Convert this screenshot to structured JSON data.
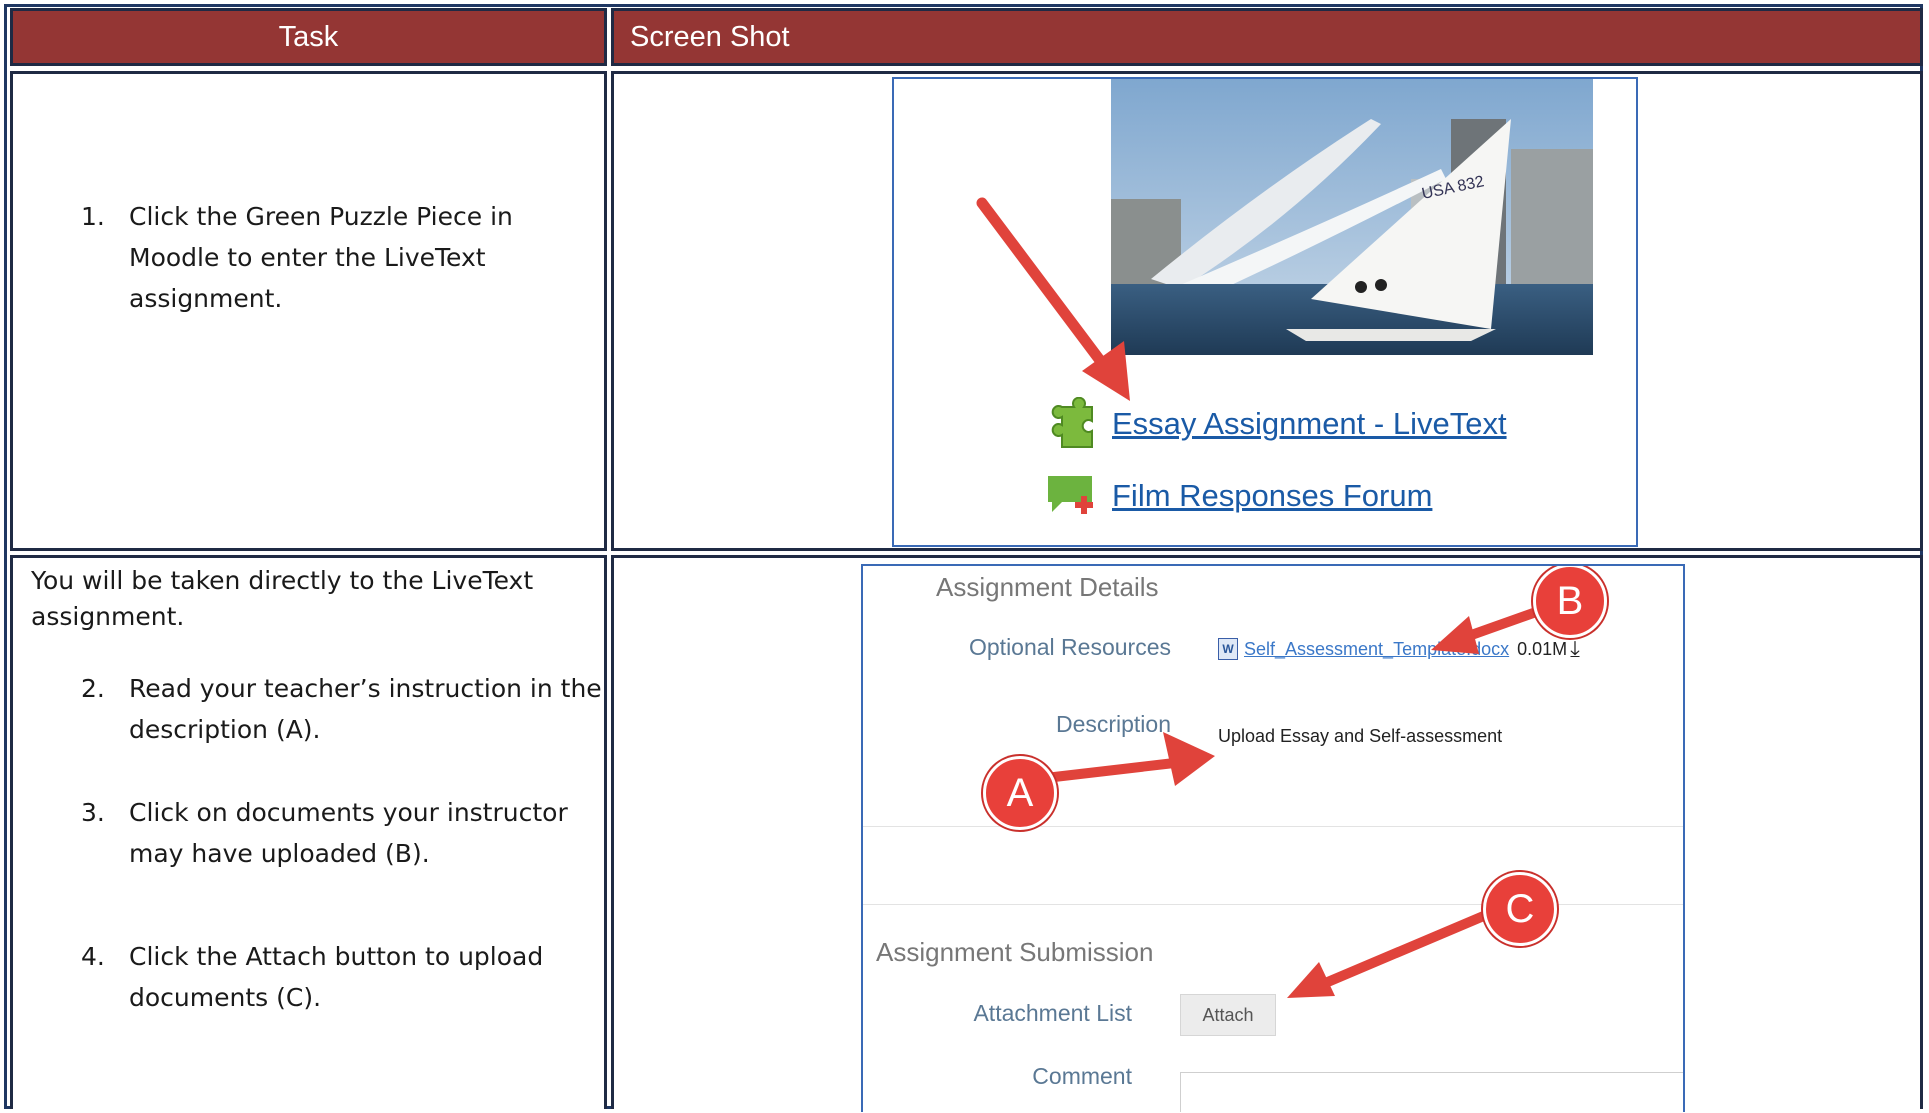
{
  "header": {
    "task": "Task",
    "screenshot": "Screen Shot"
  },
  "row1": {
    "step": {
      "number": "1.",
      "lines": [
        "Click the Green Puzzle Piece in",
        "Moodle to enter the LiveText",
        "assignment."
      ]
    },
    "shot": {
      "links": [
        {
          "label": "Essay Assignment - LiveText",
          "icon": "puzzle-piece-icon",
          "icon_color": "#7cba3d"
        },
        {
          "label": "Film Responses Forum",
          "icon": "forum-bubble-icon",
          "icon_color": "#6cb33f"
        }
      ],
      "sail_number": "USA 832"
    }
  },
  "row2": {
    "intro": [
      "You will be taken directly to the LiveText",
      "assignment."
    ],
    "steps": [
      {
        "number": "2.",
        "lines": [
          "Read your teacher’s instruction in the",
          "description (A)."
        ]
      },
      {
        "number": "3.",
        "lines": [
          "Click on documents your instructor",
          "may have uploaded (B)."
        ]
      },
      {
        "number": "4.",
        "lines": [
          "Click the Attach button to upload",
          "documents (C)."
        ]
      }
    ],
    "shot": {
      "details_title": "Assignment Details",
      "optional_label": "Optional Resources",
      "file_name": "Self_Assessment_Template.docx",
      "file_size": "0.01M",
      "description_label": "Description",
      "description_text": "Upload Essay and Self-assessment",
      "submission_title": "Assignment Submission",
      "attachment_label": "Attachment List",
      "attach_button": "Attach",
      "comment_label": "Comment",
      "markers": {
        "a": "A",
        "b": "B",
        "c": "C"
      }
    }
  },
  "colors": {
    "header_bg": "#943634",
    "border": "#1f2a44",
    "arrow": "#e0433b",
    "link": "#1a5aa6"
  }
}
